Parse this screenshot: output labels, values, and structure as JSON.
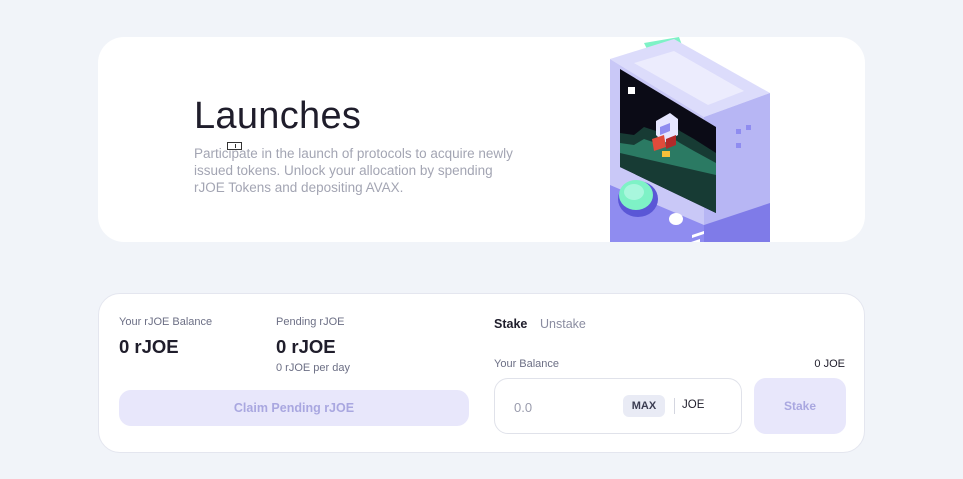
{
  "hero": {
    "title": "Launches",
    "description": "Participate in the launch of protocols to acquire newly issued tokens. Unlock your allocation by spending rJOE Tokens and depositing AVAX."
  },
  "stats": {
    "balance_label": "Your rJOE Balance",
    "balance_value": "0 rJOE",
    "pending_label": "Pending rJOE",
    "pending_value": "0 rJOE",
    "pending_rate": "0 rJOE per day",
    "claim_button": "Claim Pending rJOE"
  },
  "stake_form": {
    "tabs": [
      "Stake",
      "Unstake"
    ],
    "active_tab": "Stake",
    "balance_label": "Your Balance",
    "balance_value": "0 JOE",
    "input_placeholder": "0.0",
    "max_label": "MAX",
    "token": "JOE",
    "submit_label": "Stake"
  },
  "colors": {
    "page_bg": "#f1f4f9",
    "accent_disabled_bg": "#e8e7fb",
    "accent_disabled_text": "#a9a7e0",
    "illustration_purple": "#c9c8f7",
    "illustration_mint": "#7ef2c6"
  }
}
